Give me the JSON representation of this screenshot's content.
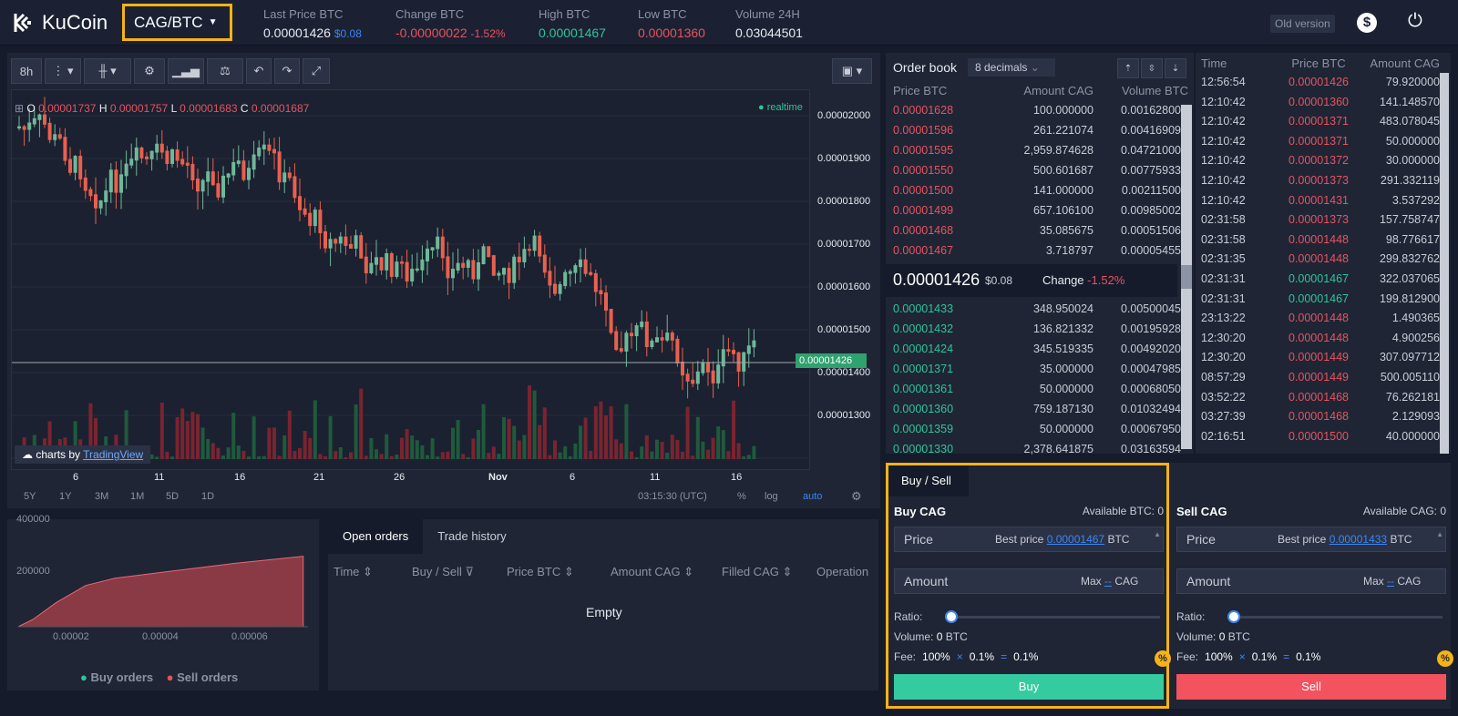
{
  "header": {
    "logo": "KuCoin",
    "pair": "CAG/BTC",
    "stats": [
      {
        "label": "Last Price BTC",
        "value": "0.00001426",
        "extra": "$0.08"
      },
      {
        "label": "Change BTC",
        "value": "-0.00000022",
        "extra": "-1.52%"
      },
      {
        "label": "High BTC",
        "value": "0.00001467"
      },
      {
        "label": "Low BTC",
        "value": "0.00001360"
      },
      {
        "label": "Volume 24H",
        "value": "0.03044501"
      }
    ],
    "old_version": "Old version"
  },
  "chart": {
    "interval": "8h",
    "ohlc": {
      "o": "0.00001737",
      "h": "0.00001757",
      "l": "0.00001683",
      "c": "0.00001687"
    },
    "realtime": "realtime",
    "tv_prefix": "charts by",
    "tv_name": "TradingView",
    "y_ticks": [
      "0.00002000",
      "0.00001900",
      "0.00001800",
      "0.00001700",
      "0.00001600",
      "0.00001500",
      "0.00001400",
      "0.00001300"
    ],
    "current_price": "0.00001426",
    "x_ticks": [
      "6",
      "11",
      "16",
      "21",
      "26",
      "Nov",
      "6",
      "11",
      "16"
    ],
    "ranges": [
      "5Y",
      "1Y",
      "3M",
      "1M",
      "5D",
      "1D"
    ],
    "time": "03:15:30 (UTC)",
    "pct": "%",
    "log": "log",
    "auto": "auto"
  },
  "chart_data": {
    "type": "line",
    "title": "",
    "x": [
      1.35e-05,
      1.6e-05,
      2e-05,
      2.5e-05,
      3e-05,
      4e-05,
      5e-05,
      6e-05,
      6.2e-05
    ],
    "series": [
      {
        "name": "Sell orders",
        "values": [
          0,
          30000,
          100000,
          170000,
          200000,
          230000,
          260000,
          285000,
          290000
        ]
      }
    ],
    "y_ticks": [
      "400000",
      "200000"
    ],
    "x_ticks": [
      "0.00002",
      "0.00004",
      "0.00006"
    ],
    "ylim": [
      0,
      420000
    ],
    "xlim": [
      1.35e-05,
      6.25e-05
    ]
  },
  "depth": {
    "legend_buy": "Buy orders",
    "legend_sell": "Sell orders"
  },
  "orders": {
    "tabs": [
      "Open orders",
      "Trade history"
    ],
    "cols": [
      "Time",
      "Buy / Sell",
      "Price BTC",
      "Amount CAG",
      "Filled CAG",
      "Operation"
    ],
    "empty": "Empty"
  },
  "orderbook": {
    "title": "Order book",
    "decimals": "8 decimals",
    "cols": [
      "Price BTC",
      "Amount CAG",
      "Volume BTC"
    ],
    "asks": [
      [
        "0.00001628",
        "100.000000",
        "0.00162800"
      ],
      [
        "0.00001596",
        "261.221074",
        "0.00416909"
      ],
      [
        "0.00001595",
        "2,959.874628",
        "0.04721000"
      ],
      [
        "0.00001550",
        "500.601687",
        "0.00775933"
      ],
      [
        "0.00001500",
        "141.000000",
        "0.00211500"
      ],
      [
        "0.00001499",
        "657.106100",
        "0.00985002"
      ],
      [
        "0.00001468",
        "35.085675",
        "0.00051506"
      ],
      [
        "0.00001467",
        "3.718797",
        "0.00005455"
      ]
    ],
    "last": "0.00001426",
    "last_usd": "$0.08",
    "change_label": "Change",
    "change": "-1.52%",
    "bids": [
      [
        "0.00001433",
        "348.950024",
        "0.00500045"
      ],
      [
        "0.00001432",
        "136.821332",
        "0.00195928"
      ],
      [
        "0.00001424",
        "345.519335",
        "0.00492020"
      ],
      [
        "0.00001371",
        "35.000000",
        "0.00047985"
      ],
      [
        "0.00001361",
        "50.000000",
        "0.00068050"
      ],
      [
        "0.00001360",
        "759.187130",
        "0.01032494"
      ],
      [
        "0.00001359",
        "50.000000",
        "0.00067950"
      ],
      [
        "0.00001330",
        "2,378.641875",
        "0.03163594"
      ]
    ]
  },
  "trades": {
    "cols": [
      "Time",
      "Price BTC",
      "Amount CAG"
    ],
    "rows": [
      [
        "12:56:54",
        "0.00001426",
        "79.920000",
        "r"
      ],
      [
        "12:10:42",
        "0.00001360",
        "141.148570",
        "r"
      ],
      [
        "12:10:42",
        "0.00001371",
        "483.078045",
        "r"
      ],
      [
        "12:10:42",
        "0.00001371",
        "50.000000",
        "r"
      ],
      [
        "12:10:42",
        "0.00001372",
        "30.000000",
        "r"
      ],
      [
        "12:10:42",
        "0.00001373",
        "291.332119",
        "r"
      ],
      [
        "12:10:42",
        "0.00001431",
        "3.537292",
        "r"
      ],
      [
        "02:31:58",
        "0.00001373",
        "157.758747",
        "r"
      ],
      [
        "02:31:58",
        "0.00001448",
        "98.776617",
        "r"
      ],
      [
        "02:31:35",
        "0.00001448",
        "299.832762",
        "r"
      ],
      [
        "02:31:31",
        "0.00001467",
        "322.037065",
        "g"
      ],
      [
        "02:31:31",
        "0.00001467",
        "199.812900",
        "g"
      ],
      [
        "23:13:22",
        "0.00001448",
        "1.490365",
        "r"
      ],
      [
        "12:30:20",
        "0.00001448",
        "4.900256",
        "r"
      ],
      [
        "12:30:20",
        "0.00001449",
        "307.097712",
        "r"
      ],
      [
        "08:57:29",
        "0.00001449",
        "500.005110",
        "r"
      ],
      [
        "03:52:22",
        "0.00001468",
        "76.262181",
        "r"
      ],
      [
        "03:27:39",
        "0.00001468",
        "2.129093",
        "r"
      ],
      [
        "02:16:51",
        "0.00001500",
        "40.000000",
        "r"
      ]
    ]
  },
  "buysell": {
    "tab": "Buy / Sell",
    "buy": {
      "title": "Buy CAG",
      "avail": "Available BTC: 0",
      "price": "Price",
      "best": "Best price",
      "best_val": "0.00001467",
      "unit": "BTC",
      "amount": "Amount",
      "max": "Max",
      "max_val": "--",
      "amt_unit": "CAG",
      "ratio": "Ratio:",
      "volume": "Volume:",
      "volume_val": "0",
      "volume_unit": "BTC",
      "fee": "Fee:",
      "fee_a": "100%",
      "x": "×",
      "fee_b": "0.1%",
      "eq": "=",
      "fee_c": "0.1%",
      "button": "Buy"
    },
    "sell": {
      "title": "Sell CAG",
      "avail": "Available CAG: 0",
      "price": "Price",
      "best": "Best price",
      "best_val": "0.00001433",
      "unit": "BTC",
      "amount": "Amount",
      "max": "Max",
      "max_val": "--",
      "amt_unit": "CAG",
      "ratio": "Ratio:",
      "volume": "Volume:",
      "volume_val": "0",
      "volume_unit": "BTC",
      "fee": "Fee:",
      "fee_a": "100%",
      "x": "×",
      "fee_b": "0.1%",
      "eq": "=",
      "fee_c": "0.1%",
      "button": "Sell"
    }
  }
}
